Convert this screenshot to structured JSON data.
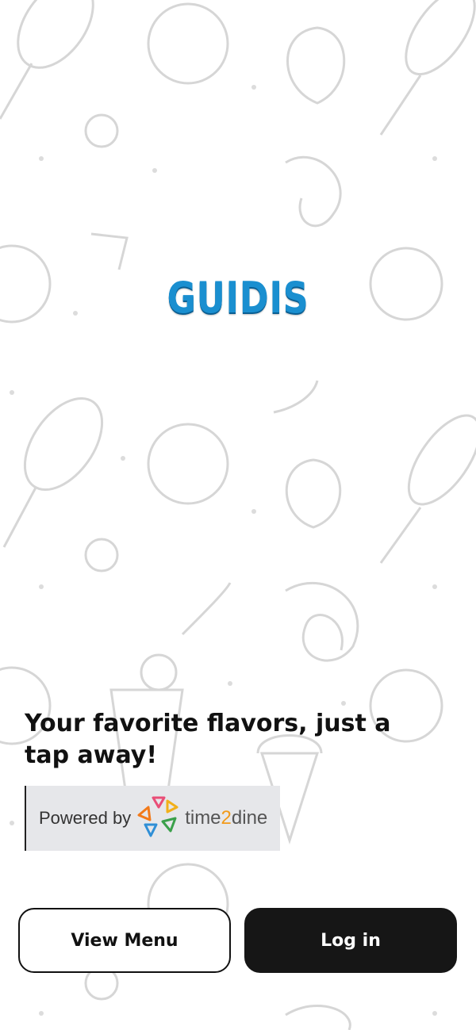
{
  "brand": {
    "logo_text": "GUIDIS",
    "logo_color": "#1a8fd0"
  },
  "tagline": "Your favorite flavors, just a tap away!",
  "powered_by": {
    "label": "Powered by",
    "brand_prefix": "time",
    "brand_digit": "2",
    "brand_suffix": "dine"
  },
  "actions": {
    "view_menu": "View Menu",
    "login": "Log in"
  },
  "colors": {
    "primary_button": "#161616",
    "accent": "#f29a1a"
  },
  "icons": [
    "food-doodle-background",
    "time2dine-logo-icon"
  ]
}
